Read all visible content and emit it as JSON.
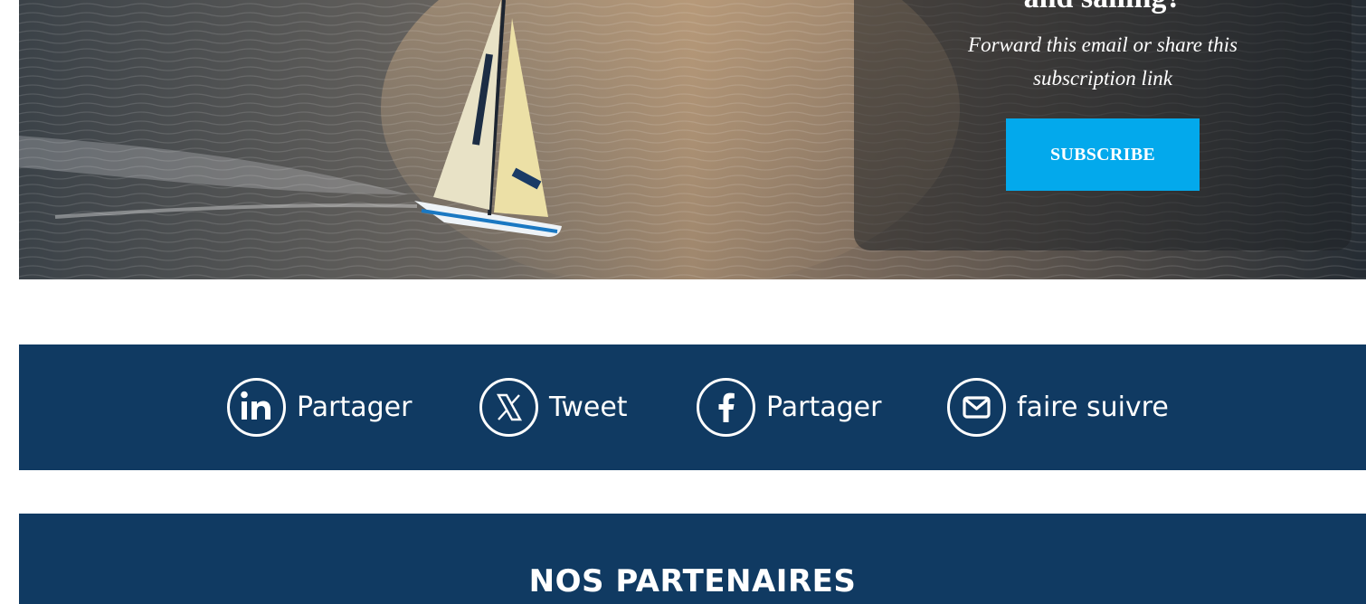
{
  "promo": {
    "heading": "and sailing?",
    "subtitle": "Forward this email or share this subscription link",
    "subscribe_label": "SUBSCRIBE"
  },
  "share": {
    "items": [
      {
        "label": "Partager",
        "icon": "linkedin-icon"
      },
      {
        "label": "Tweet",
        "icon": "x-icon"
      },
      {
        "label": "Partager",
        "icon": "facebook-icon"
      },
      {
        "label": "faire suivre",
        "icon": "mail-icon"
      }
    ]
  },
  "partners": {
    "title": "NOS PARTENAIRES"
  },
  "colors": {
    "navy": "#103a62",
    "accent": "#03a9ec"
  }
}
